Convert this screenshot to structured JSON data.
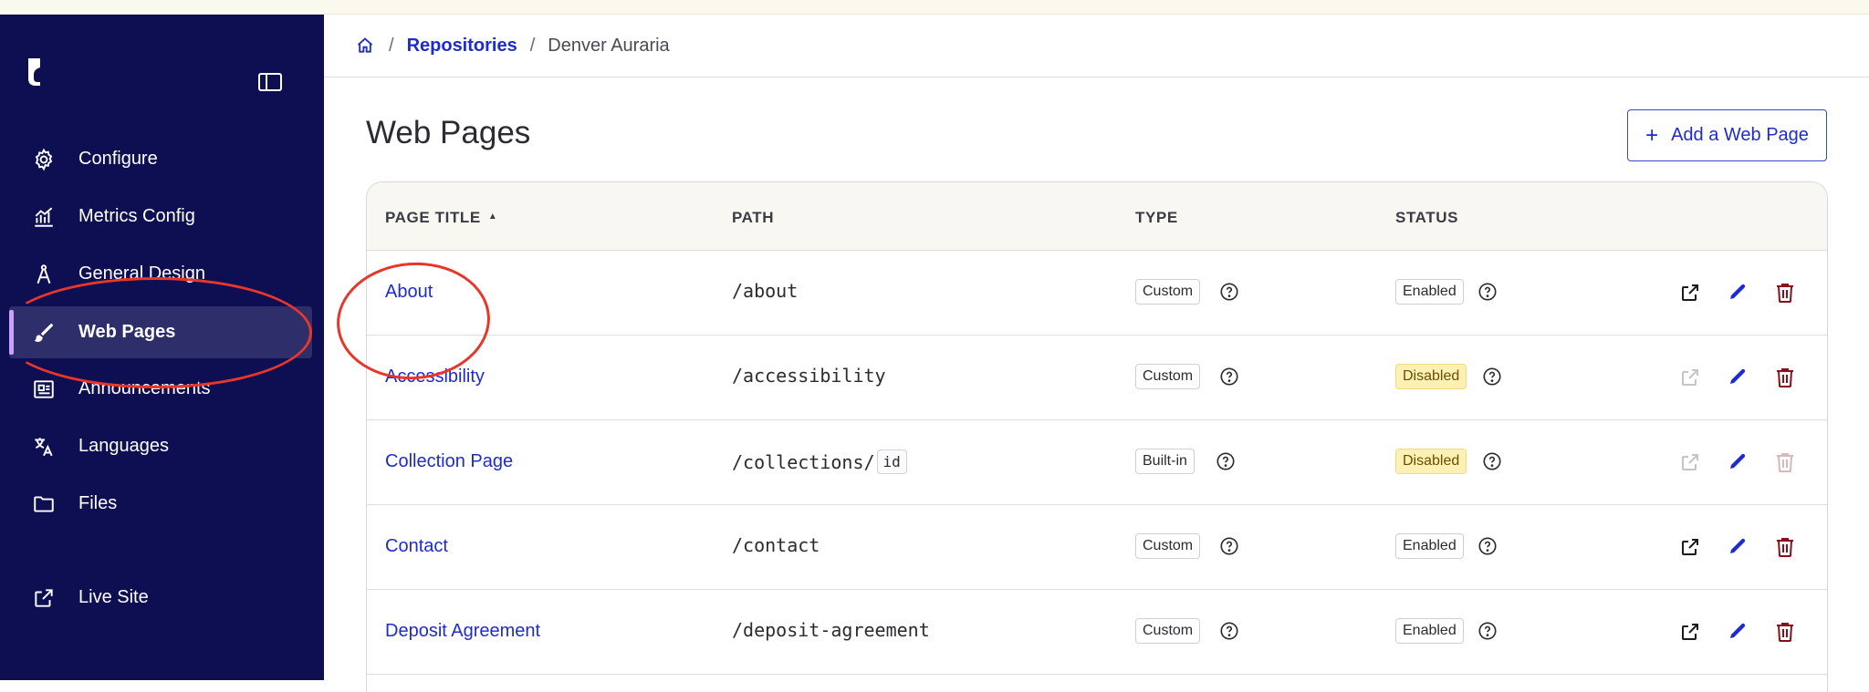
{
  "colors": {
    "sidebar_bg": "#0e0e52",
    "link": "#1e2bd1",
    "annotation": "#e8372a",
    "disabled_badge": "#fdf0b5"
  },
  "sidebar": {
    "items": [
      {
        "label": "Configure",
        "icon": "gear-icon"
      },
      {
        "label": "Metrics Config",
        "icon": "chart-icon"
      },
      {
        "label": "General Design",
        "icon": "compass-icon"
      },
      {
        "label": "Web Pages",
        "icon": "brush-icon",
        "active": true
      },
      {
        "label": "Announcements",
        "icon": "newspaper-icon"
      },
      {
        "label": "Languages",
        "icon": "translate-icon"
      },
      {
        "label": "Files",
        "icon": "folder-icon"
      },
      {
        "label": "Live Site",
        "icon": "external-link-icon"
      }
    ]
  },
  "breadcrumb": {
    "home_icon": "home-icon",
    "repositories": "Repositories",
    "current": "Denver Auraria",
    "separator": "/"
  },
  "page": {
    "title": "Web Pages",
    "add_button": "Add a Web Page",
    "add_symbol": "+"
  },
  "table": {
    "columns": {
      "title": "PAGE TITLE",
      "path": "PATH",
      "type": "TYPE",
      "status": "STATUS"
    },
    "sort_indicator": "▲",
    "rows": [
      {
        "title": "About",
        "path": "/about",
        "path_param": "",
        "type": "Custom",
        "status": "Enabled",
        "status_disabled": false,
        "view_enabled": true,
        "delete_enabled": true
      },
      {
        "title": "Accessibility",
        "path": "/accessibility",
        "path_param": "",
        "type": "Custom",
        "status": "Disabled",
        "status_disabled": true,
        "view_enabled": false,
        "delete_enabled": true
      },
      {
        "title": "Collection Page",
        "path": "/collections/",
        "path_param": "id",
        "type": "Built-in",
        "status": "Disabled",
        "status_disabled": true,
        "view_enabled": false,
        "delete_enabled": false
      },
      {
        "title": "Contact",
        "path": "/contact",
        "path_param": "",
        "type": "Custom",
        "status": "Enabled",
        "status_disabled": false,
        "view_enabled": true,
        "delete_enabled": true
      },
      {
        "title": "Deposit Agreement",
        "path": "/deposit-agreement",
        "path_param": "",
        "type": "Custom",
        "status": "Enabled",
        "status_disabled": false,
        "view_enabled": true,
        "delete_enabled": true
      }
    ]
  }
}
